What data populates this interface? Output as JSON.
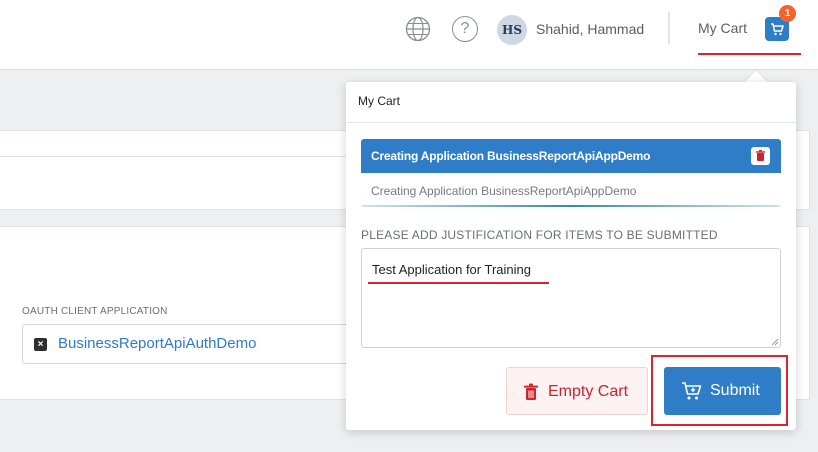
{
  "header": {
    "user_initials": "HS",
    "user_name": "Shahid, Hammad",
    "help_glyph": "?",
    "cart_link": "My Cart",
    "cart_count": "1"
  },
  "background": {
    "oauth_label": "OAUTH CLIENT APPLICATION",
    "oauth_value": "BusinessReportApiAuthDemo",
    "remove_glyph": "×"
  },
  "cart_popover": {
    "title": "My Cart",
    "items": [
      {
        "title": "Creating Application BusinessReportApiAppDemo",
        "description": "Creating Application BusinessReportApiAppDemo"
      }
    ],
    "justification_label": "PLEASE ADD JUSTIFICATION FOR ITEMS TO BE SUBMITTED",
    "justification_value": "Test Application for Training",
    "empty_cart_label": "Empty Cart",
    "submit_label": "Submit"
  },
  "icons": {
    "language": "globe-icon",
    "help": "question-circle-icon",
    "cart": "shopping-cart-icon",
    "delete": "trash-icon",
    "submit": "cart-plus-icon"
  },
  "colors": {
    "primary": "#2f7cc7",
    "danger": "#c8252d",
    "badge": "#f2642a",
    "highlight": "#d9232d"
  }
}
